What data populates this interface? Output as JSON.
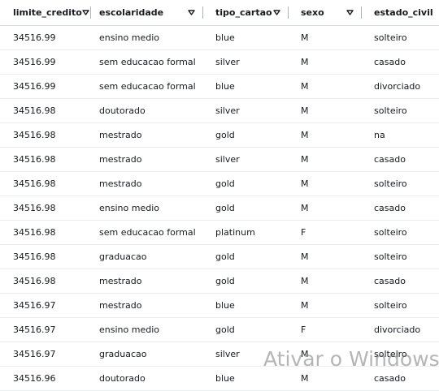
{
  "columns": [
    {
      "label": "limite_credito"
    },
    {
      "label": "escolaridade"
    },
    {
      "label": "tipo_cartao"
    },
    {
      "label": "sexo"
    },
    {
      "label": "estado_civil"
    }
  ],
  "rows": [
    [
      "34516.99",
      "ensino medio",
      "blue",
      "M",
      "solteiro"
    ],
    [
      "34516.99",
      "sem educacao formal",
      "silver",
      "M",
      "casado"
    ],
    [
      "34516.99",
      "sem educacao formal",
      "blue",
      "M",
      "divorciado"
    ],
    [
      "34516.98",
      "doutorado",
      "silver",
      "M",
      "solteiro"
    ],
    [
      "34516.98",
      "mestrado",
      "gold",
      "M",
      "na"
    ],
    [
      "34516.98",
      "mestrado",
      "silver",
      "M",
      "casado"
    ],
    [
      "34516.98",
      "mestrado",
      "gold",
      "M",
      "solteiro"
    ],
    [
      "34516.98",
      "ensino medio",
      "gold",
      "M",
      "casado"
    ],
    [
      "34516.98",
      "sem educacao formal",
      "platinum",
      "F",
      "solteiro"
    ],
    [
      "34516.98",
      "graduacao",
      "gold",
      "M",
      "solteiro"
    ],
    [
      "34516.98",
      "mestrado",
      "gold",
      "M",
      "casado"
    ],
    [
      "34516.97",
      "mestrado",
      "blue",
      "M",
      "solteiro"
    ],
    [
      "34516.97",
      "ensino medio",
      "gold",
      "F",
      "divorciado"
    ],
    [
      "34516.97",
      "graduacao",
      "silver",
      "M",
      "solteiro"
    ],
    [
      "34516.96",
      "doutorado",
      "blue",
      "M",
      "casado"
    ]
  ],
  "watermark": "Ativar o Windows",
  "colors": {
    "text": "#16191f",
    "header_border": "#d5dbdb",
    "row_border": "#eaeded",
    "separator": "#aab7b8"
  },
  "icons": {
    "sort": "caret-down-icon"
  }
}
